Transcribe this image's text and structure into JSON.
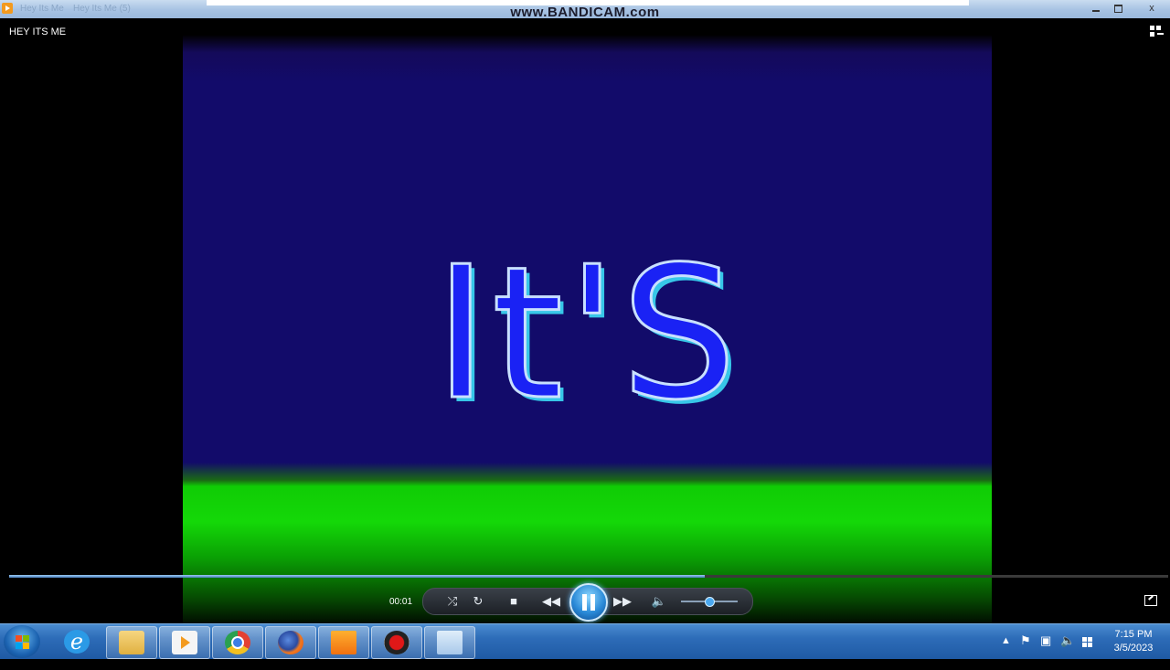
{
  "window": {
    "watermark": "www.BANDICAM.com",
    "faint_title_1": "Hey Its Me",
    "faint_title_2": "Hey Its Me (5)",
    "controls": [
      "minimize",
      "maximize",
      "close"
    ],
    "close_glyph": "x"
  },
  "player": {
    "track_title": "HEY ITS ME",
    "video_text": "It'S",
    "elapsed": "00:01",
    "seek_progress": 0.6,
    "volume": 0.5,
    "buttons": [
      "shuffle",
      "repeat",
      "stop",
      "previous",
      "pause",
      "next",
      "mute"
    ],
    "colors": {
      "sky": "#120b6a",
      "ground": "#14d808",
      "text": "#1a22f4",
      "accent": "#37c6e8"
    }
  },
  "taskbar": {
    "apps": [
      "start-orb",
      "internet-explorer",
      "windows-explorer",
      "windows-media-player",
      "google-chrome",
      "mozilla-firefox",
      "orange-app",
      "bandicam",
      "control-panel"
    ],
    "clock": {
      "time": "7:15 PM",
      "date": "3/5/2023"
    },
    "tray_icons": [
      "show-hidden-icons",
      "action-center",
      "network",
      "volume",
      "windows-flag"
    ]
  }
}
